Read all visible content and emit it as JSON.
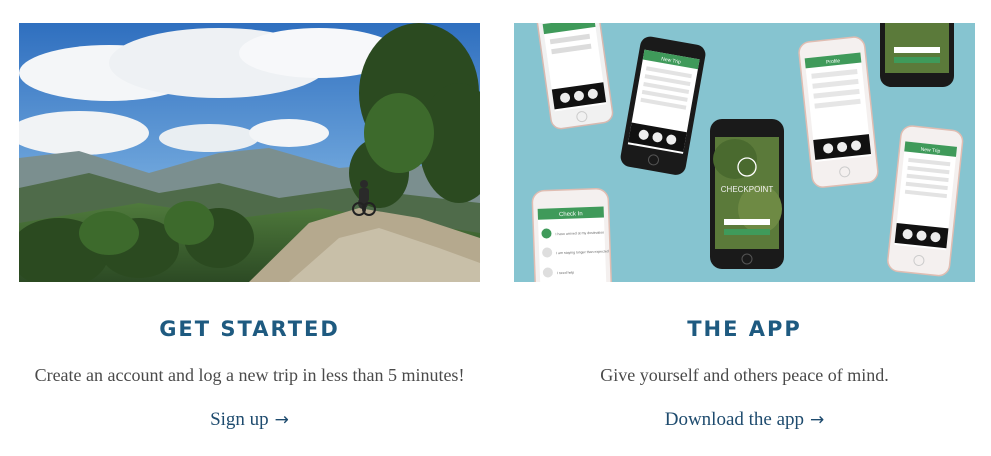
{
  "cards": [
    {
      "title": "GET STARTED",
      "description": "Create an account and log a new trip in less than 5 minutes!",
      "link_label": "Sign up",
      "link_arrow": "→"
    },
    {
      "title": "THE APP",
      "description": "Give yourself and others peace of mind.",
      "link_label": "Download the app",
      "link_arrow": "→"
    }
  ],
  "app_screens": {
    "brand": "CHECKPOINT",
    "new_trip_header": "New Trip",
    "profile_header": "Profile",
    "check_in_header": "Check In",
    "check_in_items": [
      "I have arrived at my destination",
      "I am staying longer than expected",
      "I need help"
    ]
  },
  "colors": {
    "title": "#1e5a80",
    "link": "#1e4b6e",
    "body_text": "#4a4a4a",
    "app_bg": "#86c4d0",
    "app_green": "#3f9a5a"
  }
}
